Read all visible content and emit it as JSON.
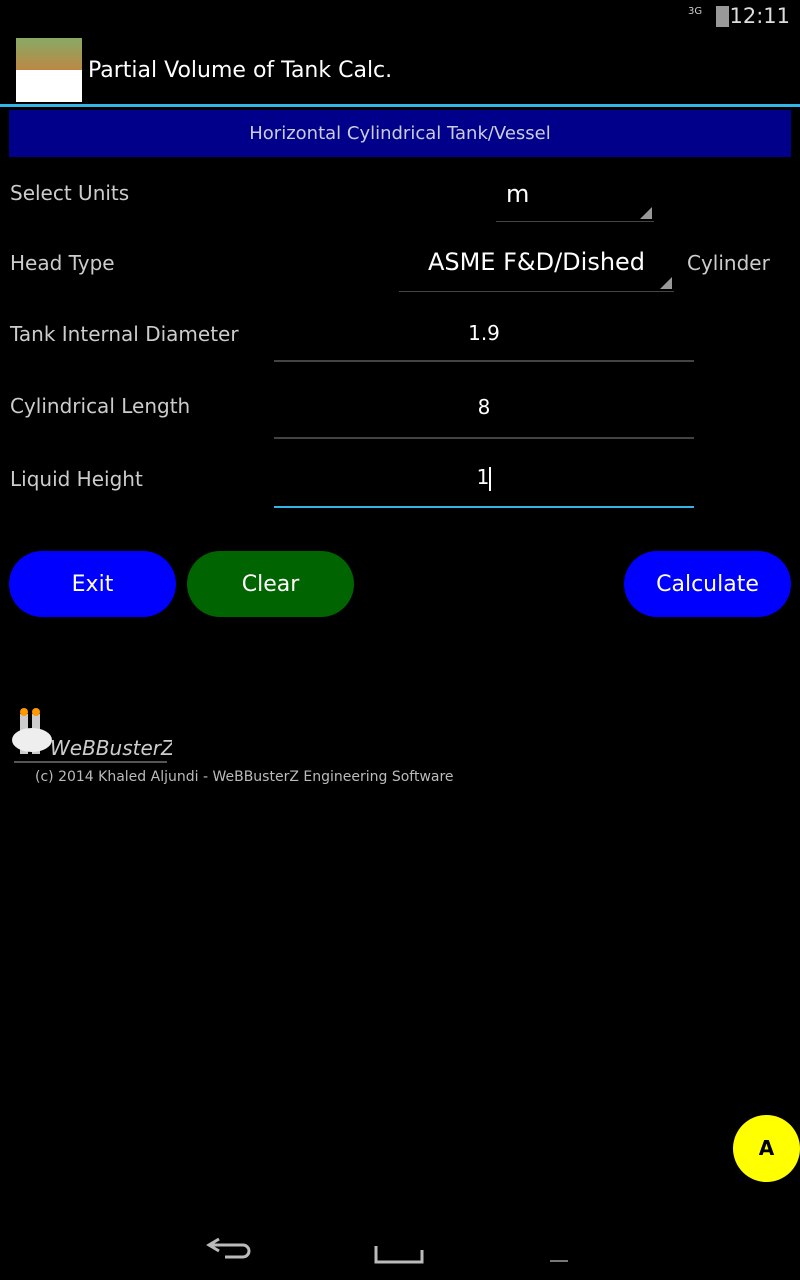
{
  "status": {
    "network": "3G",
    "time": "12:11"
  },
  "app": {
    "title": "Partial Volume of Tank Calc."
  },
  "banner": "Horizontal Cylindrical Tank/Vessel",
  "form": {
    "units_label": "Select Units",
    "units_value": "m",
    "head_label": "Head Type",
    "head_value": "ASME F&D/Dished",
    "head_note": "Cylinder",
    "diameter_label": "Tank Internal Diameter",
    "diameter_value": "1.9",
    "length_label": "Cylindrical Length",
    "length_value": "8",
    "height_label": "Liquid Height",
    "height_value": "1"
  },
  "buttons": {
    "exit": "Exit",
    "clear": "Clear",
    "calculate": "Calculate",
    "fab": "A"
  },
  "colors": {
    "exit": "#0000ff",
    "clear": "#006400",
    "calculate": "#0000ff",
    "banner": "#00008b",
    "accent": "#33b5e5",
    "fab": "#ffff00"
  },
  "footer": {
    "logo_text": "WeBBusterZ",
    "copyright": "(c) 2014 Khaled Aljundi - WeBBusterZ Engineering Software"
  }
}
